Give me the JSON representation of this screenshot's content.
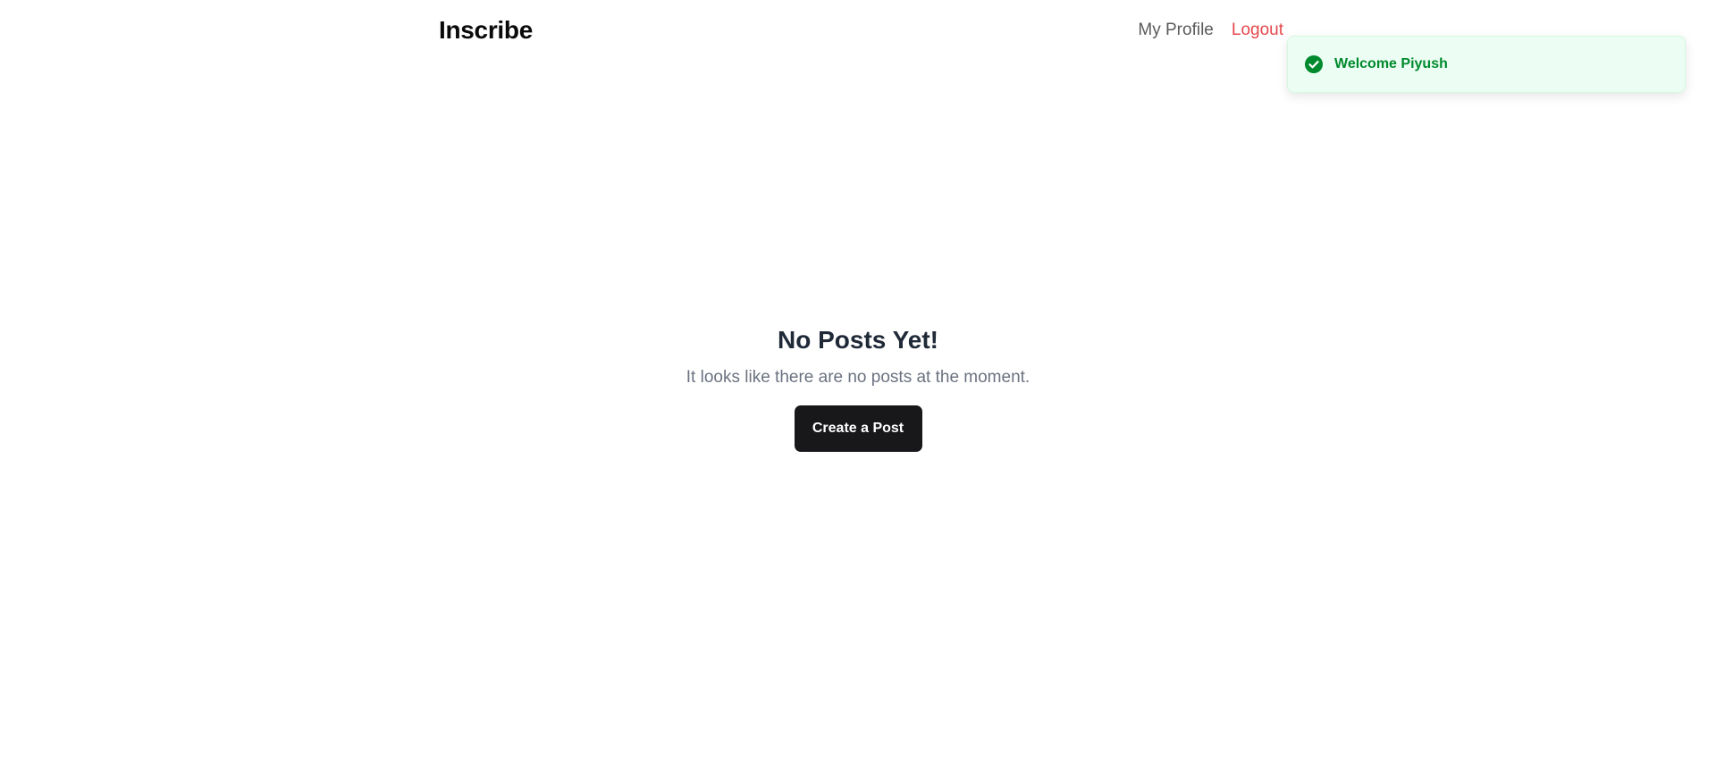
{
  "header": {
    "brand": "Inscribe",
    "nav": {
      "profile_label": "My Profile",
      "logout_label": "Logout"
    }
  },
  "toast": {
    "icon": "check-circle-icon",
    "message": "Welcome Piyush",
    "color": "#008a2e"
  },
  "main": {
    "title": "No Posts Yet!",
    "subtitle": "It looks like there are no posts at the moment.",
    "create_button_label": "Create a Post"
  },
  "colors": {
    "logout": "#e5484d",
    "button_bg": "#18181b",
    "toast_bg": "#ecfdf3"
  }
}
